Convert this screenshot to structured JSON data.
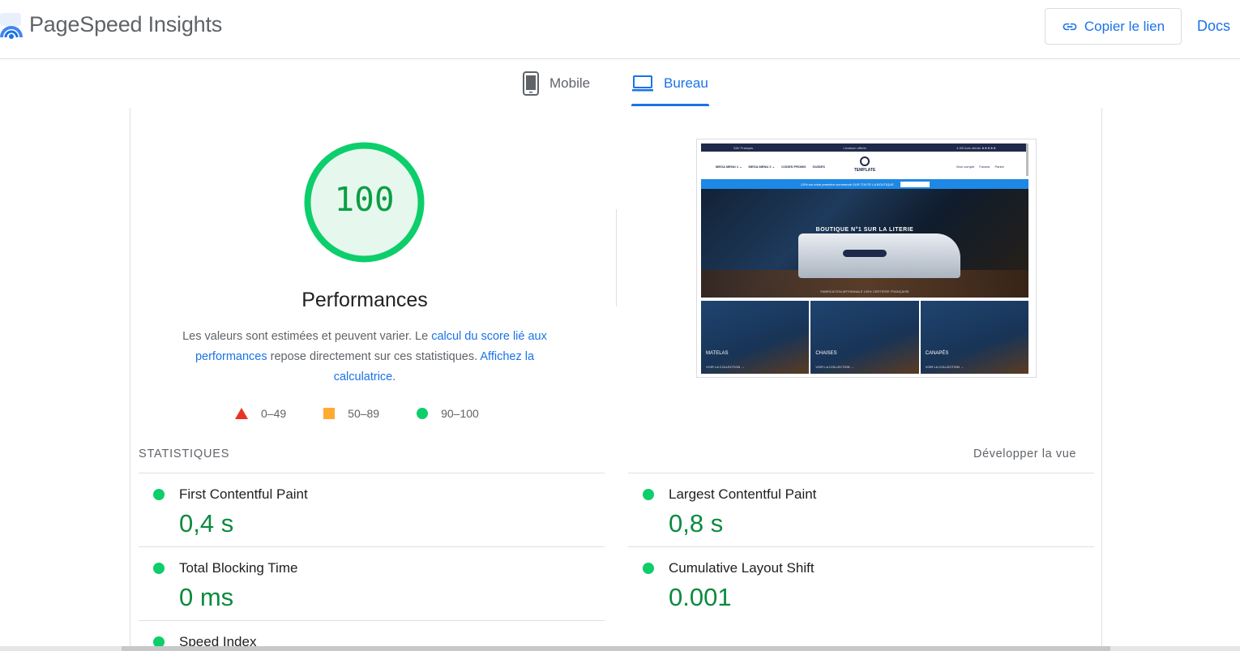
{
  "header": {
    "app_title": "PageSpeed Insights",
    "copy_link_label": "Copier le lien",
    "docs_label": "Docs"
  },
  "tabs": [
    {
      "label": "Mobile",
      "icon": "smartphone-icon",
      "selected": false
    },
    {
      "label": "Bureau",
      "icon": "laptop-icon",
      "selected": true
    }
  ],
  "score": {
    "value": "100",
    "percent": 100,
    "category": "Performances",
    "color": "#0cce6b"
  },
  "description": {
    "part1": "Les valeurs sont estimées et peuvent varier. Le ",
    "link1": "calcul du score lié aux performances",
    "part2": " repose directement sur ces statistiques. ",
    "link2": "Affichez la calculatrice",
    "part3": "."
  },
  "legend": [
    {
      "range": "0–49",
      "shape": "triangle",
      "color": "#eb3324"
    },
    {
      "range": "50–89",
      "shape": "square",
      "color": "#ffaa33"
    },
    {
      "range": "90–100",
      "shape": "circle",
      "color": "#0cce6b"
    }
  ],
  "screenshot": {
    "topbar": [
      "SAV Français",
      "Livraison offerte",
      "4.9/5 Avis clients ★★★★★"
    ],
    "nav_left": [
      "MEGA MENU 1 ⌄",
      "MEGA MENU 2 ⌄",
      "CODES PROMO",
      "GUIDES"
    ],
    "brand": "TEMPLATE",
    "nav_right": [
      "Mon compte",
      "Favoris",
      "Panier"
    ],
    "promo": "-10% sur votre première commande SUR TOUTE LA BOUTIQUE",
    "hero_title": "BOUTIQUE N°1 SUR LA LITERIE",
    "hero_foot": "FABRICATION ARTISANALE 100% CERTIFIÉE FRANÇAISE",
    "categories": [
      {
        "label": "MATELAS",
        "sub": "VOIR LA COLLECTION →"
      },
      {
        "label": "CHAISES",
        "sub": "VOIR LA COLLECTION →"
      },
      {
        "label": "CANAPÉS",
        "sub": "VOIR LA COLLECTION →"
      }
    ]
  },
  "stats": {
    "section_label": "STATISTIQUES",
    "expand_label": "Développer la vue",
    "metrics": [
      {
        "name": "First Contentful Paint",
        "value": "0,4 s"
      },
      {
        "name": "Largest Contentful Paint",
        "value": "0,8 s"
      },
      {
        "name": "Total Blocking Time",
        "value": "0 ms"
      },
      {
        "name": "Cumulative Layout Shift",
        "value": "0.001"
      },
      {
        "name": "Speed Index",
        "value": ""
      }
    ]
  }
}
